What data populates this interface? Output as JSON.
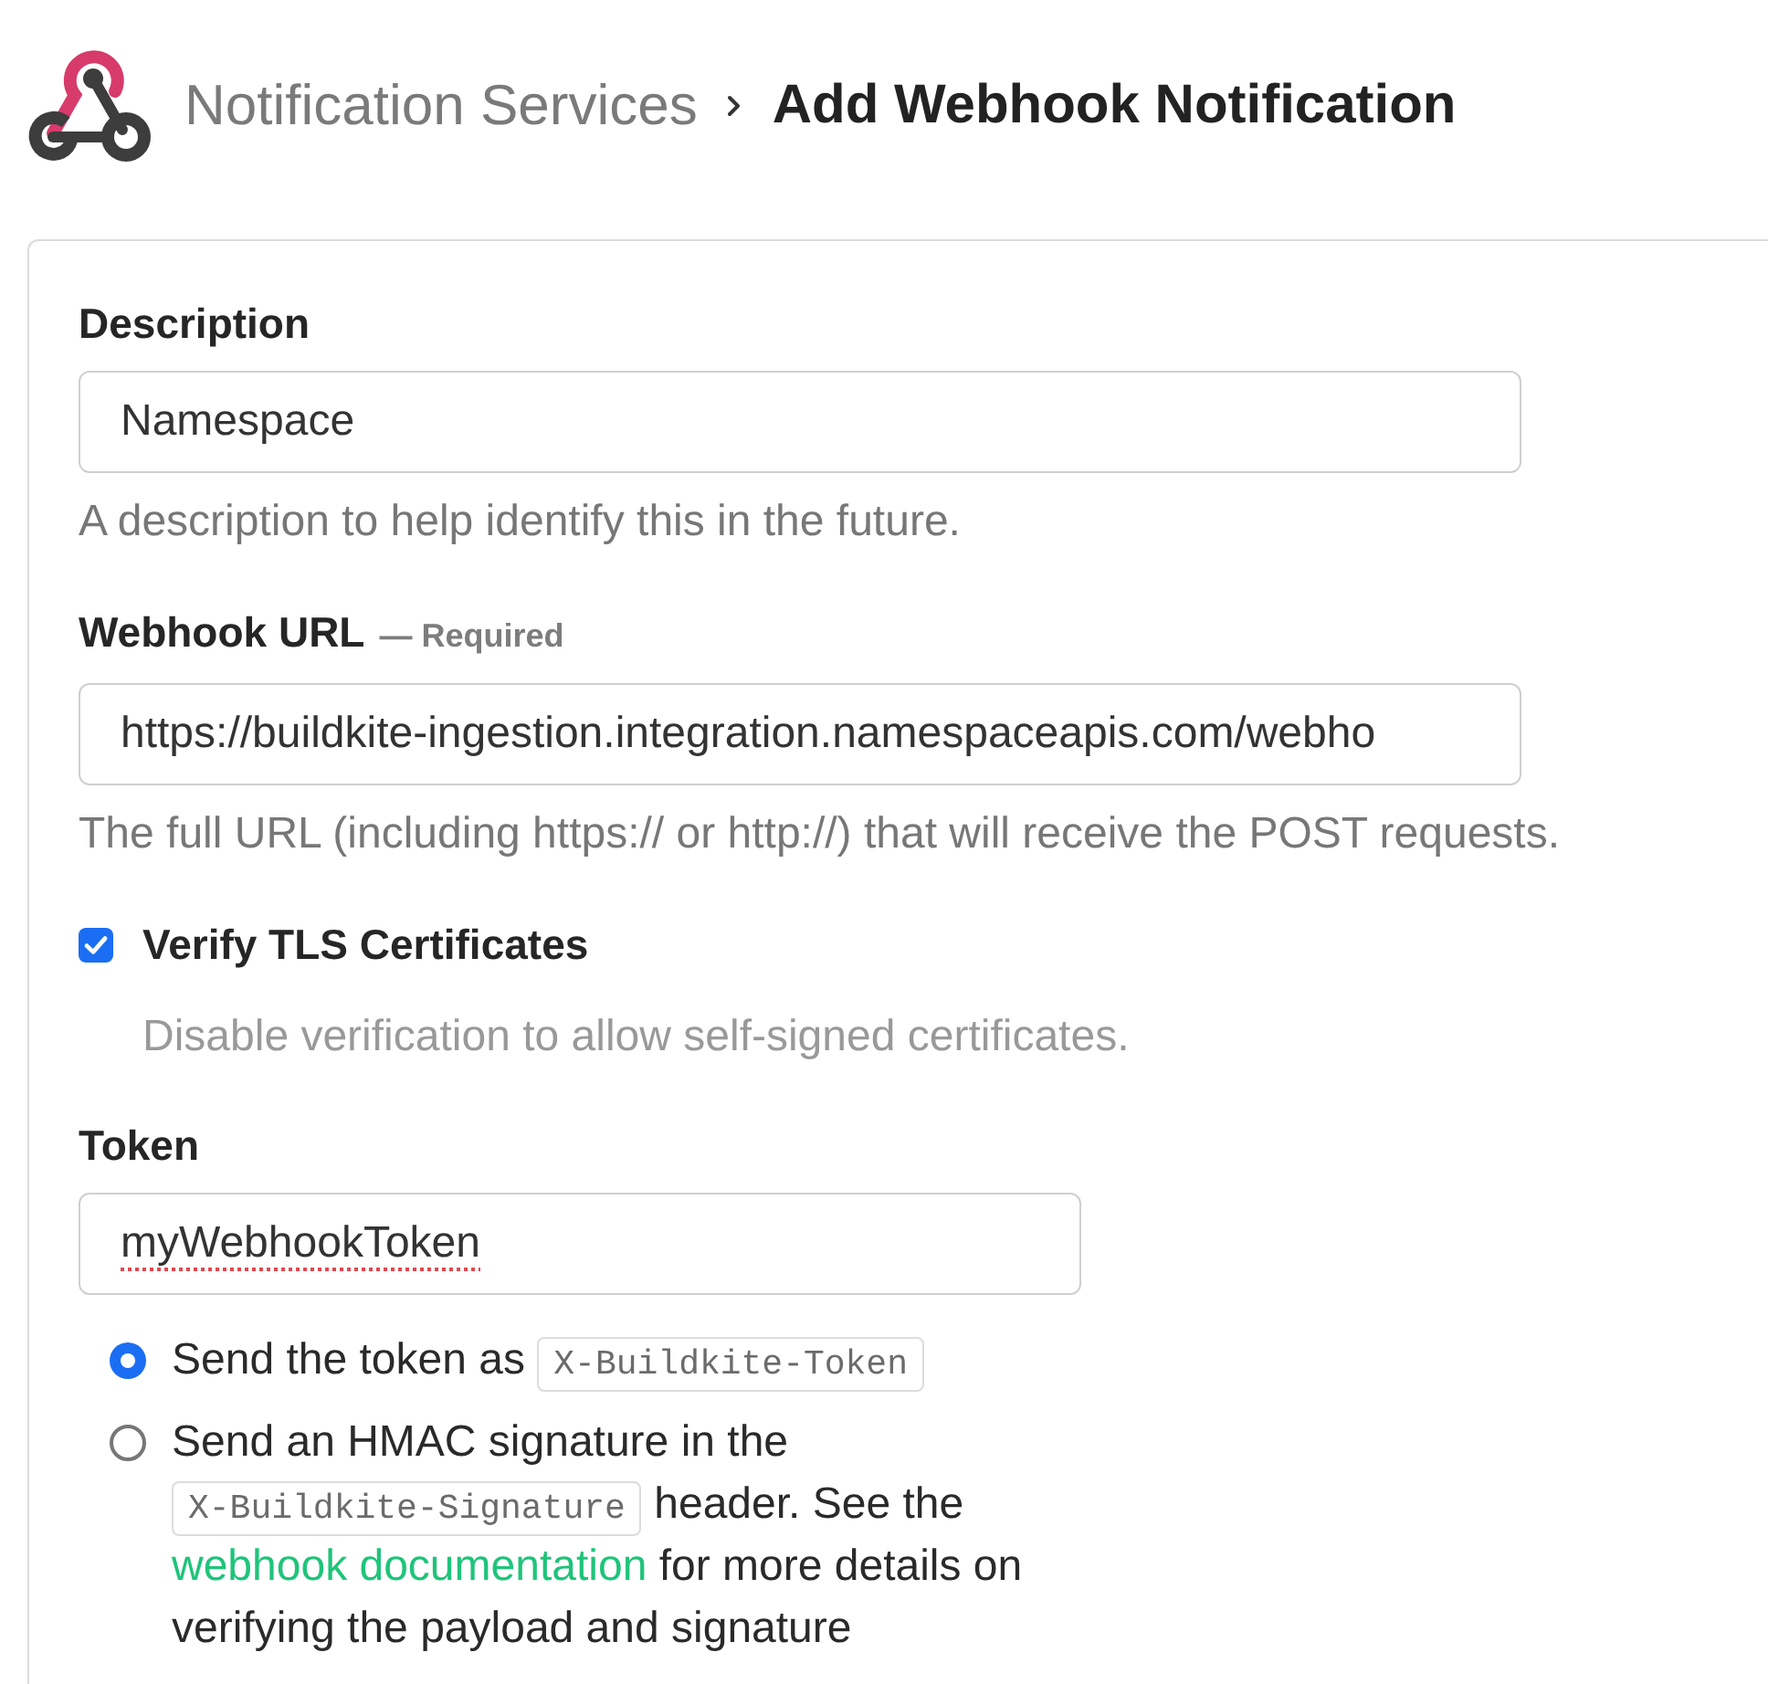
{
  "breadcrumb": {
    "parent": "Notification Services",
    "current": "Add Webhook Notification"
  },
  "form": {
    "description": {
      "label": "Description",
      "value": "Namespace",
      "help": "A description to help identify this in the future."
    },
    "webhook_url": {
      "label": "Webhook URL",
      "note": "— Required",
      "value": "https://buildkite-ingestion.integration.namespaceapis.com/webho",
      "help": "The full URL (including https:// or http://) that will receive the POST requests."
    },
    "verify_tls": {
      "label": "Verify TLS Certificates",
      "checked": true,
      "help": "Disable verification to allow self-signed certificates."
    },
    "token": {
      "label": "Token",
      "value": "myWebhookToken",
      "misspelled": true,
      "options": [
        {
          "selected": true,
          "parts": [
            {
              "kind": "text",
              "text": "Send the token as"
            },
            {
              "kind": "code",
              "text": "X-Buildkite-Token"
            }
          ]
        },
        {
          "selected": false,
          "parts": [
            {
              "kind": "text",
              "text": "Send an HMAC signature in the"
            },
            {
              "kind": "code",
              "text": "X-Buildkite-Signature"
            },
            {
              "kind": "text",
              "text": "header. See the"
            },
            {
              "kind": "link",
              "text": "webhook documentation"
            },
            {
              "kind": "text",
              "text": "for more details on verifying the payload and signature"
            }
          ]
        }
      ]
    }
  }
}
